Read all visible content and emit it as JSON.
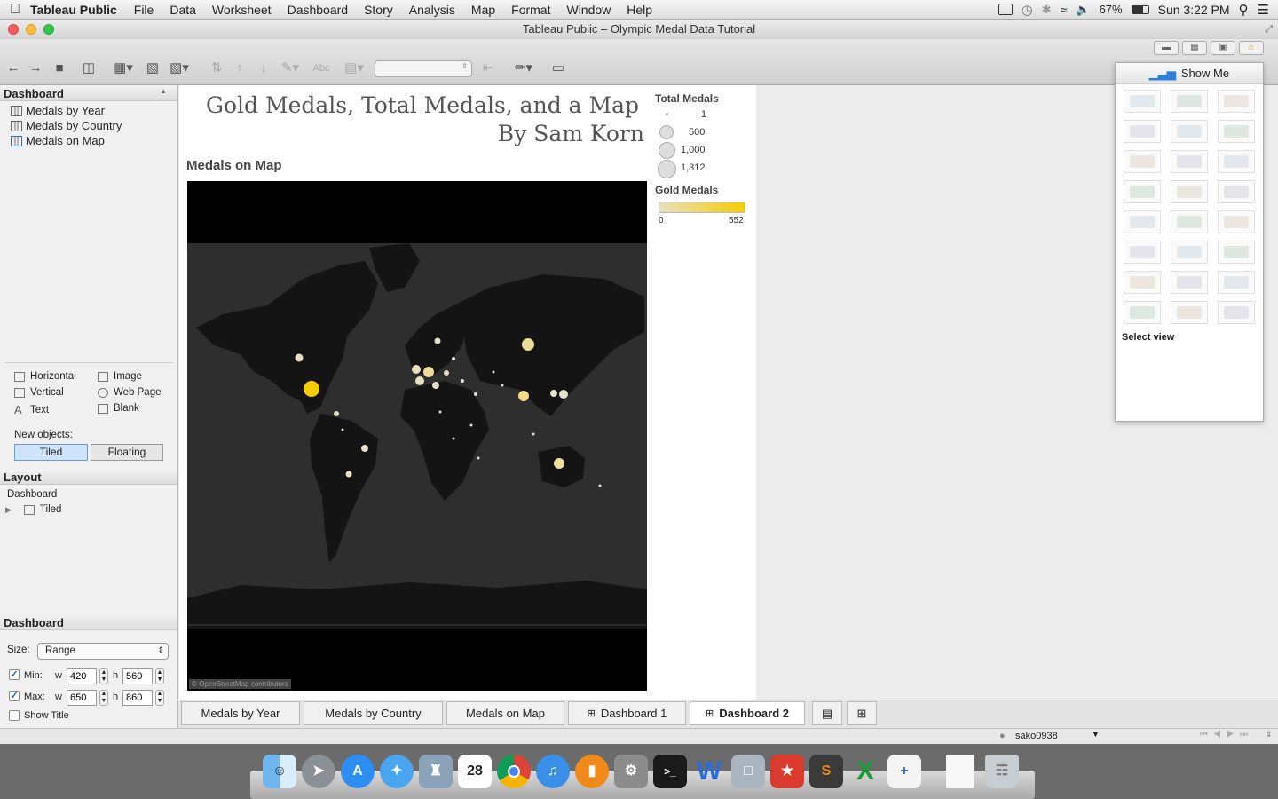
{
  "menubar": {
    "app": "Tableau Public",
    "items": [
      "File",
      "Data",
      "Worksheet",
      "Dashboard",
      "Story",
      "Analysis",
      "Map",
      "Format",
      "Window",
      "Help"
    ],
    "battery": "67%",
    "clock": "Sun 3:22 PM"
  },
  "window": {
    "title": "Tableau Public – Olympic Medal Data Tutorial"
  },
  "left_panel": {
    "dashboard_header": "Dashboard",
    "sheets": [
      "Medals by Year",
      "Medals by Country",
      "Medals on Map"
    ],
    "objects": {
      "horizontal": "Horizontal",
      "vertical": "Vertical",
      "text": "Text",
      "image": "Image",
      "web_page": "Web Page",
      "blank": "Blank"
    },
    "new_objects_label": "New objects:",
    "tiled_button": "Tiled",
    "floating_button": "Floating",
    "layout_header": "Layout",
    "layout_root": "Dashboard",
    "layout_child": "Tiled",
    "size_header": "Dashboard",
    "size_label": "Size:",
    "size_value": "Range",
    "min_label": "Min:",
    "max_label": "Max:",
    "w_label": "w",
    "h_label": "h",
    "min_w": "420",
    "min_h": "560",
    "max_w": "650",
    "max_h": "860",
    "show_title": "Show Title"
  },
  "dashboard": {
    "title_line1": "Gold Medals, Total Medals, and a Map",
    "title_line2": "By Sam Korn",
    "map_title": "Medals on Map",
    "attribution": "© OpenStreetMap contributors",
    "legend_total": {
      "title": "Total Medals",
      "entries": [
        "1",
        "500",
        "1,000",
        "1,312"
      ]
    },
    "legend_gold": {
      "title": "Gold Medals",
      "min": "0",
      "max": "552",
      "color_low": "#e8e0c0",
      "color_high": "#f5cc00"
    }
  },
  "show_me": {
    "title": "Show Me",
    "status": "Select view"
  },
  "tabs": [
    "Medals by Year",
    "Medals by Country",
    "Medals on Map",
    "Dashboard 1",
    "Dashboard 2"
  ],
  "status": {
    "user": "sako0938"
  },
  "colors": {
    "gold": "#f5cc00",
    "map_land": "#333333",
    "map_bg": "#000000"
  }
}
